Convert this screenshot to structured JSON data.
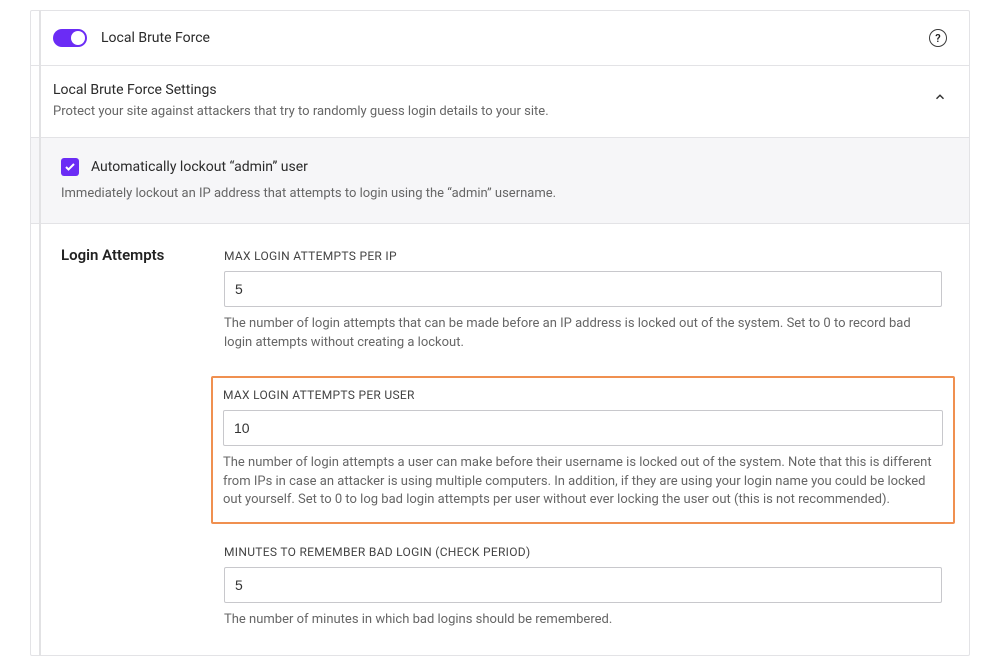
{
  "header": {
    "title": "Local Brute Force"
  },
  "subheader": {
    "title": "Local Brute Force Settings",
    "desc": "Protect your site against attackers that try to randomly guess login details to your site."
  },
  "checkbox": {
    "label": "Automatically lockout “admin” user",
    "desc": "Immediately lockout an IP address that attempts to login using the “admin” username."
  },
  "form": {
    "section_title": "Login Attempts",
    "fields": [
      {
        "label": "MAX LOGIN ATTEMPTS PER IP",
        "value": "5",
        "help": "The number of login attempts that can be made before an IP address is locked out of the system. Set to 0 to record bad login attempts without creating a lockout."
      },
      {
        "label": "MAX LOGIN ATTEMPTS PER USER",
        "value": "10",
        "help": "The number of login attempts a user can make before their username is locked out of the system. Note that this is different from IPs in case an attacker is using multiple computers. In addition, if they are using your login name you could be locked out yourself. Set to 0 to log bad login attempts per user without ever locking the user out (this is not recommended)."
      },
      {
        "label": "MINUTES TO REMEMBER BAD LOGIN (CHECK PERIOD)",
        "value": "5",
        "help": "The number of minutes in which bad logins should be remembered."
      }
    ]
  }
}
